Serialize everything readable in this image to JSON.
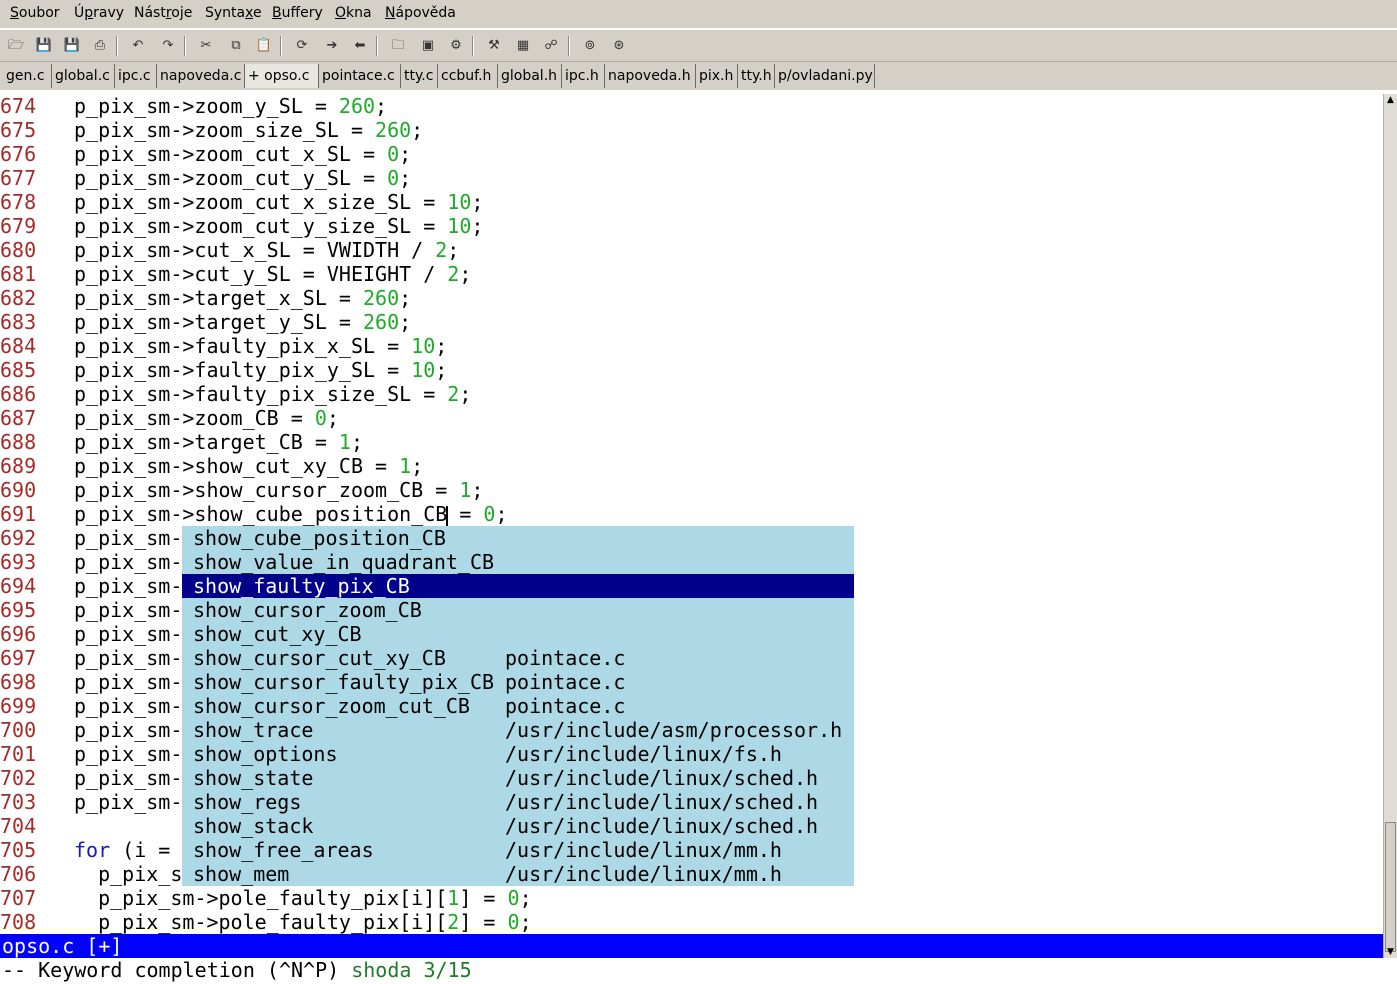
{
  "menu": [
    "Soubor",
    "Úpravy",
    "Nástroje",
    "Syntaxe",
    "Buffery",
    "Okna",
    "Nápověda"
  ],
  "menu_mnemonics": [
    "S",
    "p",
    "r",
    "x",
    "B",
    "O",
    "N"
  ],
  "toolbar": [
    {
      "name": "open-icon",
      "glyph": "🗁"
    },
    {
      "name": "save-icon",
      "glyph": "💾"
    },
    {
      "name": "save-all-icon",
      "glyph": "💾"
    },
    {
      "name": "print-icon",
      "glyph": "⎙"
    },
    {
      "name": "undo-icon",
      "glyph": "↶"
    },
    {
      "name": "redo-icon",
      "glyph": "↷"
    },
    {
      "name": "cut-icon",
      "glyph": "✂"
    },
    {
      "name": "copy-icon",
      "glyph": "⧉"
    },
    {
      "name": "paste-icon",
      "glyph": "📋"
    },
    {
      "name": "load-session-icon",
      "glyph": "⟳"
    },
    {
      "name": "find-next-icon",
      "glyph": "➔"
    },
    {
      "name": "find-prev-icon",
      "glyph": "⬅"
    },
    {
      "name": "session-open-icon",
      "glyph": "🗀"
    },
    {
      "name": "session-save-icon",
      "glyph": "▣"
    },
    {
      "name": "run-script-icon",
      "glyph": "⚙"
    },
    {
      "name": "make-icon",
      "glyph": "⚒"
    },
    {
      "name": "shell-icon",
      "glyph": "▦"
    },
    {
      "name": "ctags-icon",
      "glyph": "☍"
    },
    {
      "name": "jump-tag-icon",
      "glyph": "⊚"
    },
    {
      "name": "help-icon",
      "glyph": "⊛"
    }
  ],
  "tabs": [
    "gen.c",
    "global.c",
    "ipc.c",
    "napoveda.c",
    "+ opso.c",
    "pointace.c",
    "tty.c",
    "ccbuf.h",
    "global.h",
    "ipc.h",
    "napoveda.h",
    "pix.h",
    "tty.h",
    "p/ovladani.py"
  ],
  "active_tab": 4,
  "lines": [
    {
      "n": "674",
      "indent": "",
      "code": [
        [
          "p_pix_sm->zoom_y_SL = ",
          ""
        ],
        [
          "260",
          "num"
        ],
        [
          ";",
          ""
        ]
      ]
    },
    {
      "n": "675",
      "indent": "",
      "code": [
        [
          "p_pix_sm->zoom_size_SL = ",
          ""
        ],
        [
          "260",
          "num"
        ],
        [
          ";",
          ""
        ]
      ]
    },
    {
      "n": "676",
      "indent": "",
      "code": [
        [
          "p_pix_sm->zoom_cut_x_SL = ",
          ""
        ],
        [
          "0",
          "num"
        ],
        [
          ";",
          ""
        ]
      ]
    },
    {
      "n": "677",
      "indent": "",
      "code": [
        [
          "p_pix_sm->zoom_cut_y_SL = ",
          ""
        ],
        [
          "0",
          "num"
        ],
        [
          ";",
          ""
        ]
      ]
    },
    {
      "n": "678",
      "indent": "",
      "code": [
        [
          "p_pix_sm->zoom_cut_x_size_SL = ",
          ""
        ],
        [
          "10",
          "num"
        ],
        [
          ";",
          ""
        ]
      ]
    },
    {
      "n": "679",
      "indent": "",
      "code": [
        [
          "p_pix_sm->zoom_cut_y_size_SL = ",
          ""
        ],
        [
          "10",
          "num"
        ],
        [
          ";",
          ""
        ]
      ]
    },
    {
      "n": "680",
      "indent": "",
      "code": [
        [
          "p_pix_sm->cut_x_SL = VWIDTH / ",
          ""
        ],
        [
          "2",
          "num"
        ],
        [
          ";",
          ""
        ]
      ]
    },
    {
      "n": "681",
      "indent": "",
      "code": [
        [
          "p_pix_sm->cut_y_SL = VHEIGHT / ",
          ""
        ],
        [
          "2",
          "num"
        ],
        [
          ";",
          ""
        ]
      ]
    },
    {
      "n": "682",
      "indent": "",
      "code": [
        [
          "p_pix_sm->target_x_SL = ",
          ""
        ],
        [
          "260",
          "num"
        ],
        [
          ";",
          ""
        ]
      ]
    },
    {
      "n": "683",
      "indent": "",
      "code": [
        [
          "p_pix_sm->target_y_SL = ",
          ""
        ],
        [
          "260",
          "num"
        ],
        [
          ";",
          ""
        ]
      ]
    },
    {
      "n": "684",
      "indent": "",
      "code": [
        [
          "p_pix_sm->faulty_pix_x_SL = ",
          ""
        ],
        [
          "10",
          "num"
        ],
        [
          ";",
          ""
        ]
      ]
    },
    {
      "n": "685",
      "indent": "",
      "code": [
        [
          "p_pix_sm->faulty_pix_y_SL = ",
          ""
        ],
        [
          "10",
          "num"
        ],
        [
          ";",
          ""
        ]
      ]
    },
    {
      "n": "686",
      "indent": "",
      "code": [
        [
          "p_pix_sm->faulty_pix_size_SL = ",
          ""
        ],
        [
          "2",
          "num"
        ],
        [
          ";",
          ""
        ]
      ]
    },
    {
      "n": "687",
      "indent": "",
      "code": [
        [
          "p_pix_sm->zoom_CB = ",
          ""
        ],
        [
          "0",
          "num"
        ],
        [
          ";",
          ""
        ]
      ]
    },
    {
      "n": "688",
      "indent": "",
      "code": [
        [
          "p_pix_sm->target_CB = ",
          ""
        ],
        [
          "1",
          "num"
        ],
        [
          ";",
          ""
        ]
      ]
    },
    {
      "n": "689",
      "indent": "",
      "code": [
        [
          "p_pix_sm->show_cut_xy_CB = ",
          ""
        ],
        [
          "1",
          "num"
        ],
        [
          ";",
          ""
        ]
      ]
    },
    {
      "n": "690",
      "indent": "",
      "code": [
        [
          "p_pix_sm->show_cursor_zoom_CB = ",
          ""
        ],
        [
          "1",
          "num"
        ],
        [
          ";",
          ""
        ]
      ]
    },
    {
      "n": "691",
      "indent": "",
      "cursor_after": 0,
      "code": [
        [
          "p_pix_sm->show_cube_position_CB",
          ""
        ],
        [
          " = ",
          ""
        ],
        [
          "0",
          "num"
        ],
        [
          ";",
          ""
        ]
      ]
    },
    {
      "n": "692",
      "indent": "",
      "code": [
        [
          "p_pix_sm-",
          ""
        ]
      ]
    },
    {
      "n": "693",
      "indent": "",
      "code": [
        [
          "p_pix_sm-",
          ""
        ]
      ]
    },
    {
      "n": "694",
      "indent": "",
      "code": [
        [
          "p_pix_sm-",
          ""
        ]
      ]
    },
    {
      "n": "695",
      "indent": "",
      "code": [
        [
          "p_pix_sm-",
          ""
        ]
      ]
    },
    {
      "n": "696",
      "indent": "",
      "code": [
        [
          "p_pix_sm-",
          ""
        ]
      ]
    },
    {
      "n": "697",
      "indent": "",
      "code": [
        [
          "p_pix_sm-",
          ""
        ]
      ]
    },
    {
      "n": "698",
      "indent": "",
      "code": [
        [
          "p_pix_sm-",
          ""
        ]
      ]
    },
    {
      "n": "699",
      "indent": "",
      "code": [
        [
          "p_pix_sm-",
          ""
        ]
      ]
    },
    {
      "n": "700",
      "indent": "",
      "code": [
        [
          "p_pix_sm-",
          ""
        ]
      ]
    },
    {
      "n": "701",
      "indent": "",
      "code": [
        [
          "p_pix_sm-",
          ""
        ]
      ]
    },
    {
      "n": "702",
      "indent": "",
      "code": [
        [
          "p_pix_sm-",
          ""
        ]
      ]
    },
    {
      "n": "703",
      "indent": "",
      "code": [
        [
          "p_pix_sm-",
          ""
        ]
      ]
    },
    {
      "n": "704",
      "indent": "",
      "code": []
    },
    {
      "n": "705",
      "indent": "",
      "code": [
        [
          "for",
          "kw"
        ],
        [
          " (i =",
          ""
        ]
      ]
    },
    {
      "n": "706",
      "indent": "  ",
      "code": [
        [
          "p_pix_s",
          ""
        ]
      ]
    },
    {
      "n": "707",
      "indent": "  ",
      "code": [
        [
          "p_pix_sm->pole_faulty_pix[i][",
          ""
        ],
        [
          "1",
          "num"
        ],
        [
          "] = ",
          ""
        ],
        [
          "0",
          "num"
        ],
        [
          ";",
          ""
        ]
      ]
    },
    {
      "n": "708",
      "indent": "  ",
      "code": [
        [
          "p_pix_sm->pole_faulty_pix[i][",
          ""
        ],
        [
          "2",
          "num"
        ],
        [
          "] = ",
          ""
        ],
        [
          "0",
          "num"
        ],
        [
          ";",
          ""
        ]
      ]
    }
  ],
  "completion": {
    "selected": 2,
    "items": [
      {
        "word": "show_cube_position_CB",
        "file": ""
      },
      {
        "word": "show_value_in_quadrant_CB",
        "file": ""
      },
      {
        "word": "show_faulty_pix_CB",
        "file": ""
      },
      {
        "word": "show_cursor_zoom_CB",
        "file": ""
      },
      {
        "word": "show_cut_xy_CB",
        "file": ""
      },
      {
        "word": "show_cursor_cut_xy_CB",
        "file": "pointace.c"
      },
      {
        "word": "show_cursor_faulty_pix_CB",
        "file": "pointace.c"
      },
      {
        "word": "show_cursor_zoom_cut_CB",
        "file": "pointace.c"
      },
      {
        "word": "show_trace",
        "file": "/usr/include/asm/processor.h"
      },
      {
        "word": "show_options",
        "file": "/usr/include/linux/fs.h"
      },
      {
        "word": "show_state",
        "file": "/usr/include/linux/sched.h"
      },
      {
        "word": "show_regs",
        "file": "/usr/include/linux/sched.h"
      },
      {
        "word": "show_stack",
        "file": "/usr/include/linux/sched.h"
      },
      {
        "word": "show_free_areas",
        "file": "/usr/include/linux/mm.h"
      },
      {
        "word": "show_mem",
        "file": "/usr/include/linux/mm.h"
      }
    ]
  },
  "statusline": "opso.c [+]",
  "cmdline": {
    "mode": "-- Keyword completion (^N^P) ",
    "match": "shoda 3/15"
  },
  "colors": {
    "line_number": "#a52a2a",
    "number": "#1faa2a",
    "keyword": "#1a1aa6",
    "popup_bg": "#add8e6",
    "popup_sel": "#00008b",
    "statusline": "#0000ff"
  }
}
